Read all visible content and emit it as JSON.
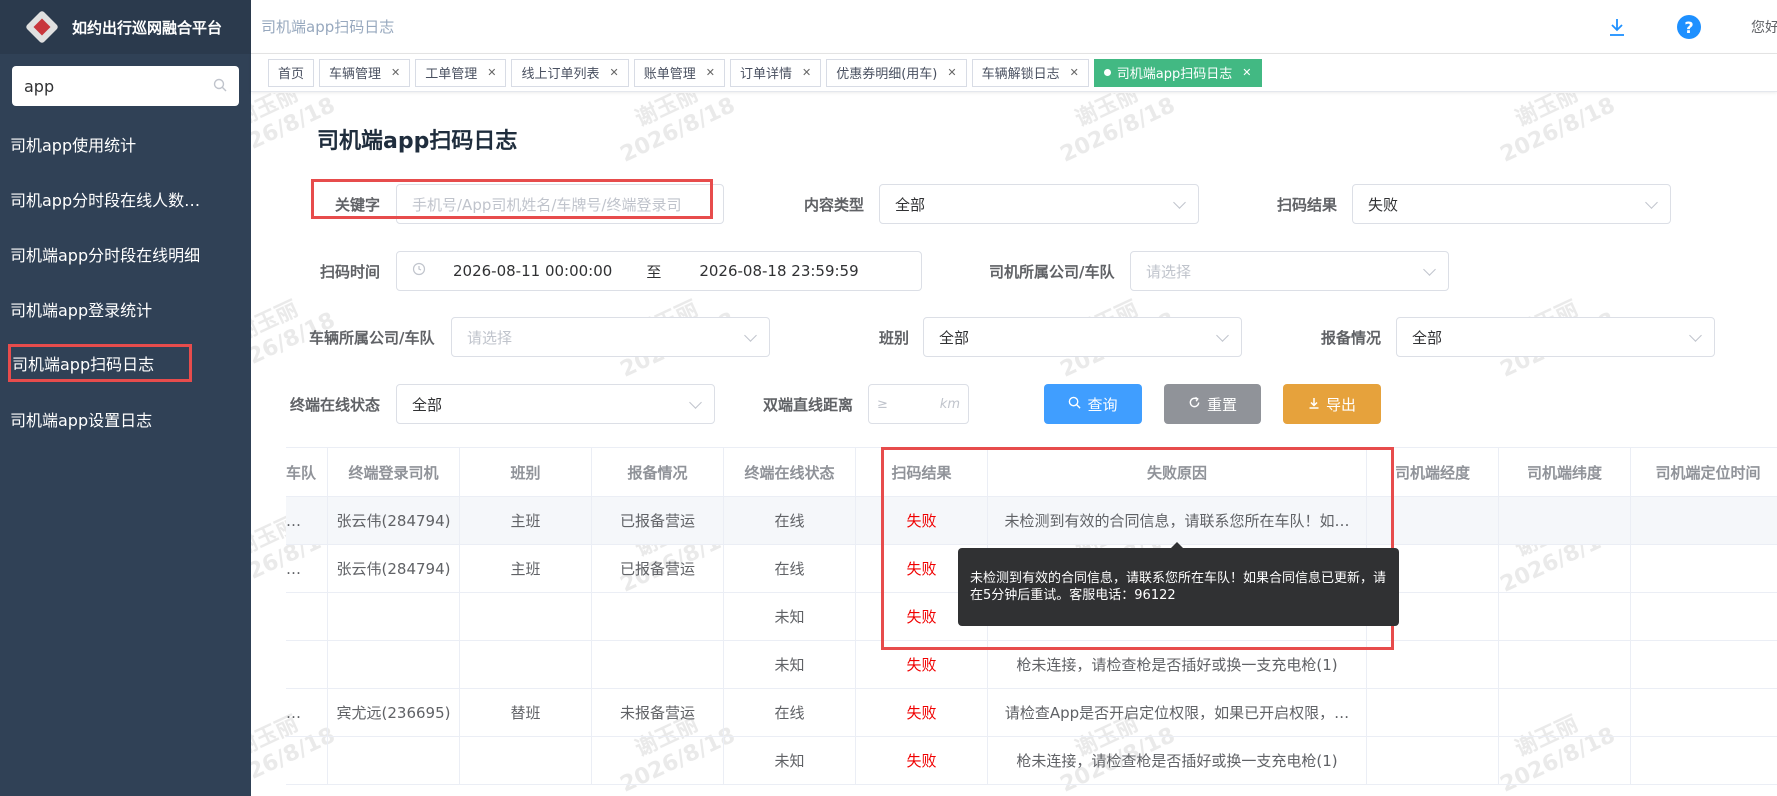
{
  "brand": {
    "title": "如约出行巡网融合平台"
  },
  "sidebar": {
    "search_value": "app",
    "items": [
      {
        "label": "司机app使用统计"
      },
      {
        "label": "司机app分时段在线人数…"
      },
      {
        "label": "司机端app分时段在线明细"
      },
      {
        "label": "司机端app登录统计"
      },
      {
        "label": "司机端app扫码日志"
      },
      {
        "label": "司机端app设置日志"
      }
    ]
  },
  "header": {
    "breadcrumb": "司机端app扫码日志",
    "user": "您好"
  },
  "tabs": [
    {
      "label": "首页"
    },
    {
      "label": "车辆管理"
    },
    {
      "label": "工单管理"
    },
    {
      "label": "线上订单列表"
    },
    {
      "label": "账单管理"
    },
    {
      "label": "订单详情"
    },
    {
      "label": "优惠券明细(用车)"
    },
    {
      "label": "车辆解锁日志"
    },
    {
      "label": "司机端app扫码日志"
    }
  ],
  "page": {
    "title": "司机端app扫码日志"
  },
  "filters": {
    "keyword_label": "关键字",
    "keyword_placeholder": "手机号/App司机姓名/车牌号/终端登录司",
    "content_type_label": "内容类型",
    "content_type_value": "全部",
    "scan_result_label": "扫码结果",
    "scan_result_value": "失败",
    "scan_time_label": "扫码时间",
    "scan_time_start": "2026-08-11 00:00:00",
    "scan_time_sep": "至",
    "scan_time_end": "2026-08-18 23:59:59",
    "driver_company_label": "司机所属公司/车队",
    "driver_company_placeholder": "请选择",
    "vehicle_company_label": "车辆所属公司/车队",
    "vehicle_company_placeholder": "请选择",
    "shift_label": "班别",
    "shift_value": "全部",
    "report_label": "报备情况",
    "report_value": "全部",
    "terminal_status_label": "终端在线状态",
    "terminal_status_value": "全部",
    "distance_label": "双端直线距离",
    "distance_prefix": "≥",
    "distance_unit": "km"
  },
  "buttons": {
    "query": "查询",
    "reset": "重置",
    "export": "导出"
  },
  "table": {
    "headers": [
      "车队",
      "终端登录司机",
      "班别",
      "报备情况",
      "终端在线状态",
      "扫码结果",
      "失败原因",
      "司机端经度",
      "司机端纬度",
      "司机端定位时间"
    ],
    "rows": [
      [
        "…",
        "张云伟(284794)",
        "主班",
        "已报备营运",
        "在线",
        "失败",
        "未检测到有效的合同信息，请联系您所在车队！如…",
        "",
        "",
        ""
      ],
      [
        "…",
        "张云伟(284794)",
        "主班",
        "已报备营运",
        "在线",
        "失败",
        "",
        "",
        "",
        ""
      ],
      [
        "",
        "",
        "",
        "",
        "未知",
        "失败",
        "",
        "",
        "",
        ""
      ],
      [
        "",
        "",
        "",
        "",
        "未知",
        "失败",
        "枪未连接，请检查枪是否插好或换一支充电枪(1)",
        "",
        "",
        ""
      ],
      [
        "…",
        "宾尤远(236695)",
        "替班",
        "未报备营运",
        "在线",
        "失败",
        "请检查App是否开启定位权限，如果已开启权限，…",
        "",
        "",
        ""
      ],
      [
        "",
        "",
        "",
        "",
        "未知",
        "失败",
        "枪未连接，请检查枪是否插好或换一支充电枪(1)",
        "",
        "",
        ""
      ]
    ]
  },
  "tooltip": {
    "text": "未检测到有效的合同信息，请联系您所在车队！如果合同信息已更新，请在5分钟后重试。客服电话：96122"
  },
  "watermark": {
    "name": "谢玉丽",
    "date": "2026/8/18"
  },
  "colors": {
    "sidebar": "#304156",
    "active_tab": "#42b983",
    "primary": "#409eff",
    "warning": "#e6a23c",
    "danger": "#f00000",
    "highlight": "#e74c4c"
  }
}
